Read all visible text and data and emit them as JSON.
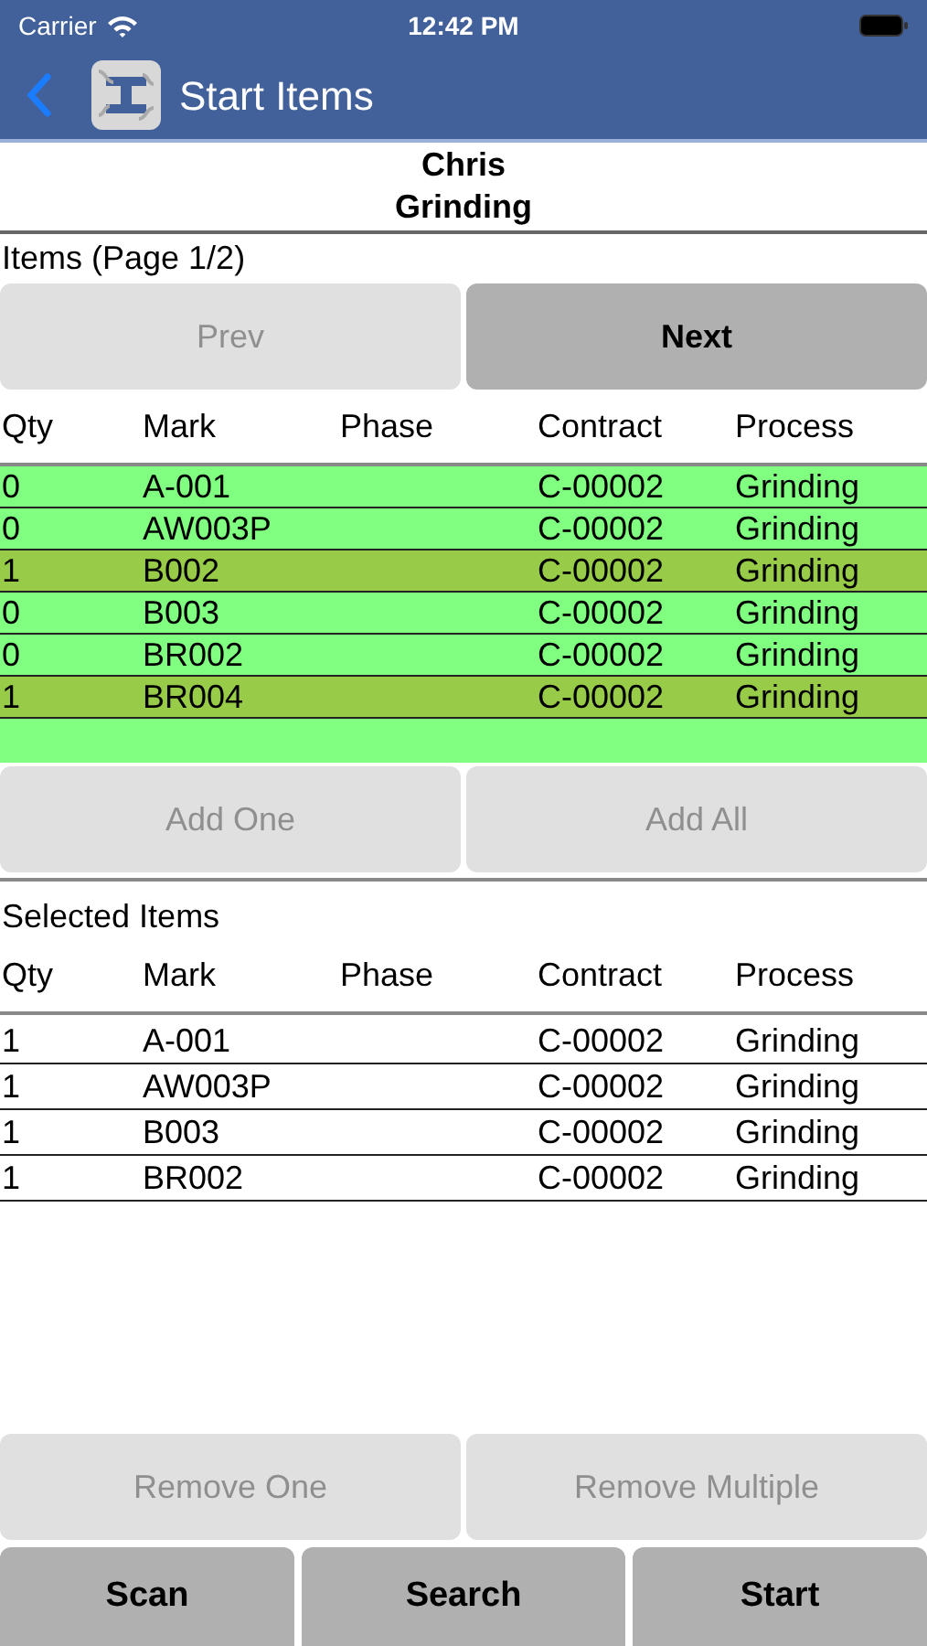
{
  "status_bar": {
    "carrier": "Carrier",
    "time": "12:42 PM"
  },
  "nav": {
    "title": "Start Items"
  },
  "header": {
    "name": "Chris",
    "process": "Grinding"
  },
  "items": {
    "title": "Items (Page 1/2)",
    "pager": [
      {
        "label": "Prev",
        "disabled": true
      },
      {
        "label": "Next",
        "disabled": false
      }
    ],
    "columns": [
      "Qty",
      "Mark",
      "Phase",
      "Contract",
      "Process"
    ],
    "rows": [
      {
        "cells": [
          "0",
          "A-001",
          "",
          "C-00002",
          "Grinding"
        ],
        "selected": false
      },
      {
        "cells": [
          "0",
          "AW003P",
          "",
          "C-00002",
          "Grinding"
        ],
        "selected": false
      },
      {
        "cells": [
          "1",
          "B002",
          "",
          "C-00002",
          "Grinding"
        ],
        "selected": true
      },
      {
        "cells": [
          "0",
          "B003",
          "",
          "C-00002",
          "Grinding"
        ],
        "selected": false
      },
      {
        "cells": [
          "0",
          "BR002",
          "",
          "C-00002",
          "Grinding"
        ],
        "selected": false
      },
      {
        "cells": [
          "1",
          "BR004",
          "",
          "C-00002",
          "Grinding"
        ],
        "selected": true
      }
    ],
    "actions": [
      {
        "label": "Add One",
        "disabled": true
      },
      {
        "label": "Add All",
        "disabled": true
      }
    ]
  },
  "selected_items": {
    "title": "Selected Items",
    "columns": [
      "Qty",
      "Mark",
      "Phase",
      "Contract",
      "Process"
    ],
    "rows": [
      {
        "cells": [
          "1",
          "A-001",
          "",
          "C-00002",
          "Grinding"
        ]
      },
      {
        "cells": [
          "1",
          "AW003P",
          "",
          "C-00002",
          "Grinding"
        ]
      },
      {
        "cells": [
          "1",
          "B003",
          "",
          "C-00002",
          "Grinding"
        ]
      },
      {
        "cells": [
          "1",
          "BR002",
          "",
          "C-00002",
          "Grinding"
        ]
      }
    ],
    "actions": [
      {
        "label": "Remove One",
        "disabled": true
      },
      {
        "label": "Remove Multiple",
        "disabled": true
      }
    ]
  },
  "toolbar": [
    {
      "label": "Scan"
    },
    {
      "label": "Search"
    },
    {
      "label": "Start"
    }
  ]
}
